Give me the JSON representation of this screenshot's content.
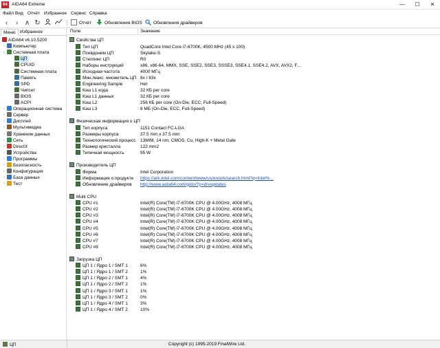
{
  "window": {
    "app_icon_text": "64",
    "title": "AIDA64 Extreme",
    "min_label": "—",
    "max_label": "☐",
    "close_label": "✕"
  },
  "menu": [
    "Файл",
    "Вид",
    "Отчёт",
    "Избранное",
    "Сервис",
    "Справка"
  ],
  "toolbar": {
    "report_label": "Отчёт",
    "bios_update_label": "Обновления BIOS",
    "driver_update_label": "Обновления драйверов"
  },
  "left_tabs": [
    "Меню",
    "Избранное"
  ],
  "tree": [
    {
      "label": "AIDA64 v6.10.5200",
      "level": 0,
      "arrow": "",
      "icon_color": "#c1272d"
    },
    {
      "label": "Компьютер",
      "level": 1,
      "arrow": "›",
      "icon_color": "#3c6fb4"
    },
    {
      "label": "Системная плата",
      "level": 1,
      "arrow": "⌄",
      "icon_color": "#4a7a3a"
    },
    {
      "label": "ЦП",
      "level": 2,
      "arrow": "",
      "icon_color": "#4a6b3a",
      "selected": true
    },
    {
      "label": "CPUID",
      "level": 2,
      "arrow": "",
      "icon_color": "#4a6b3a"
    },
    {
      "label": "Системная плата",
      "level": 2,
      "arrow": "",
      "icon_color": "#4a6b3a"
    },
    {
      "label": "Память",
      "level": 2,
      "arrow": "",
      "icon_color": "#3a6e9a"
    },
    {
      "label": "SPD",
      "level": 2,
      "arrow": "",
      "icon_color": "#3a6e9a"
    },
    {
      "label": "Чипсет",
      "level": 2,
      "arrow": "",
      "icon_color": "#4a6b3a"
    },
    {
      "label": "BIOS",
      "level": 2,
      "arrow": "",
      "icon_color": "#6a6a6a"
    },
    {
      "label": "ACPI",
      "level": 2,
      "arrow": "",
      "icon_color": "#6a6a6a"
    },
    {
      "label": "Операционная система",
      "level": 1,
      "arrow": "›",
      "icon_color": "#2f7fd0"
    },
    {
      "label": "Сервер",
      "level": 1,
      "arrow": "›",
      "icon_color": "#6d6d6d"
    },
    {
      "label": "Дисплей",
      "level": 1,
      "arrow": "›",
      "icon_color": "#2f7fd0"
    },
    {
      "label": "Мультимедиа",
      "level": 1,
      "arrow": "›",
      "icon_color": "#8a5a2a"
    },
    {
      "label": "Хранение данных",
      "level": 1,
      "arrow": "›",
      "icon_color": "#777777"
    },
    {
      "label": "Сеть",
      "level": 1,
      "arrow": "›",
      "icon_color": "#2f8f4f"
    },
    {
      "label": "DirectX",
      "level": 1,
      "arrow": "›",
      "icon_color": "#c0392b"
    },
    {
      "label": "Устройства",
      "level": 1,
      "arrow": "›",
      "icon_color": "#555555"
    },
    {
      "label": "Программы",
      "level": 1,
      "arrow": "›",
      "icon_color": "#2f7fd0"
    },
    {
      "label": "Безопасность",
      "level": 1,
      "arrow": "›",
      "icon_color": "#d4a017"
    },
    {
      "label": "Конфигурация",
      "level": 1,
      "arrow": "›",
      "icon_color": "#666666"
    },
    {
      "label": "База данных",
      "level": 1,
      "arrow": "›",
      "icon_color": "#3c6fb4"
    },
    {
      "label": "Тест",
      "level": 1,
      "arrow": "›",
      "icon_color": "#d4a017"
    }
  ],
  "columns": {
    "field": "Поле",
    "value": "Значение"
  },
  "sections": [
    {
      "title": "Свойства ЦП",
      "rows": [
        {
          "field": "Тип ЦП",
          "value": "QuadCore Intel Core i7-6700K, 4500 MHz (45 x 100)"
        },
        {
          "field": "Псевдоним ЦП",
          "value": "Skylake-S"
        },
        {
          "field": "Степпинг ЦП",
          "value": "R0"
        },
        {
          "field": "Наборы инструкций",
          "value": "x86, x86-64, MMX, SSE, SSE2, SSE3, SSSE3, SSE4.1, SSE4.2, AVX, AVX2, F..."
        },
        {
          "field": "Исходная частота",
          "value": "4000 МГц"
        },
        {
          "field": "Мин./макс. множитель ЦП",
          "value": "8x / 83x"
        },
        {
          "field": "Engineering Sample",
          "value": "Нет"
        },
        {
          "field": "Кэш L1 кода",
          "value": "32 КБ per core"
        },
        {
          "field": "Кэш L1 данных",
          "value": "32 КБ per core"
        },
        {
          "field": "Кэш L2",
          "value": "256 КБ per core  (On-Die, ECC, Full-Speed)"
        },
        {
          "field": "Кэш L3",
          "value": "8 МБ  (On-Die, ECC, Full-Speed)"
        }
      ]
    },
    {
      "title": "Физическая информация о ЦП",
      "rows": [
        {
          "field": "Тип корпуса",
          "value": "1151 Contact FC-LGA"
        },
        {
          "field": "Размеры корпуса",
          "value": "37.5 mm x 37.5 mm"
        },
        {
          "field": "Технологический процесс",
          "value": "13MiM, 14 nm, CMOS, Cu, High-K + Metal Gate"
        },
        {
          "field": "Размер кристалла",
          "value": "122 mm2"
        },
        {
          "field": "Типичная мощность",
          "value": "95 W"
        }
      ]
    },
    {
      "title": "Производитель ЦП",
      "rows": [
        {
          "field": "Фирма",
          "value": "Intel Corporation"
        },
        {
          "field": "Информация о продукте",
          "value": "https://ark.intel.com/content/www/us/en/ark/search.html?q=Intel%...",
          "link": true
        },
        {
          "field": "Обновление драйверов",
          "value": "http://www.aida64.com/goto/?p=drvupdates",
          "link": true
        }
      ]
    },
    {
      "title": "Multi CPU",
      "rows": [
        {
          "field": "CPU #1",
          "value": "Intel(R) Core(TM) i7-6700K CPU @ 4.00GHz, 4008 МГц"
        },
        {
          "field": "CPU #2",
          "value": "Intel(R) Core(TM) i7-6700K CPU @ 4.00GHz, 4008 МГц"
        },
        {
          "field": "CPU #3",
          "value": "Intel(R) Core(TM) i7-6700K CPU @ 4.00GHz, 4008 МГц"
        },
        {
          "field": "CPU #4",
          "value": "Intel(R) Core(TM) i7-6700K CPU @ 4.00GHz, 4008 МГц"
        },
        {
          "field": "CPU #5",
          "value": "Intel(R) Core(TM) i7-6700K CPU @ 4.00GHz, 4008 МГц"
        },
        {
          "field": "CPU #6",
          "value": "Intel(R) Core(TM) i7-6700K CPU @ 4.00GHz, 4008 МГц"
        },
        {
          "field": "CPU #7",
          "value": "Intel(R) Core(TM) i7-6700K CPU @ 4.00GHz, 4008 МГц"
        },
        {
          "field": "CPU #8",
          "value": "Intel(R) Core(TM) i7-6700K CPU @ 4.00GHz, 4008 МГц"
        }
      ]
    },
    {
      "title": "Загрузка ЦП",
      "rows": [
        {
          "field": "ЦП 1 / Ядро 1 / SMT 1",
          "value": "6%"
        },
        {
          "field": "ЦП 1 / Ядро 1 / SMT 2",
          "value": "1%"
        },
        {
          "field": "ЦП 1 / Ядро 2 / SMT 1",
          "value": "4%"
        },
        {
          "field": "ЦП 1 / Ядро 2 / SMT 2",
          "value": "1%"
        },
        {
          "field": "ЦП 1 / Ядро 3 / SMT 1",
          "value": "1%"
        },
        {
          "field": "ЦП 1 / Ядро 3 / SMT 2",
          "value": "0%"
        },
        {
          "field": "ЦП 1 / Ядро 4 / SMT 1",
          "value": "3%"
        },
        {
          "field": "ЦП 1 / Ядро 4 / SMT 2",
          "value": "10%"
        }
      ]
    }
  ],
  "status": {
    "left": "ЦП",
    "center": "Copyright (c) 1995-2019 FinalWire Ltd."
  }
}
